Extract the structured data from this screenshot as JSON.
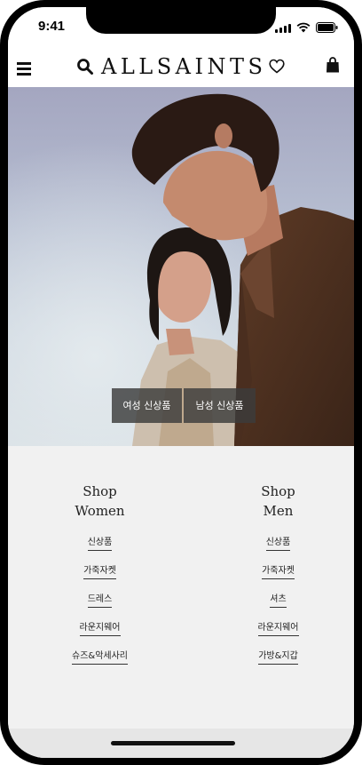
{
  "status": {
    "time": "9:41",
    "icons": [
      "cellular-signal-icon",
      "wifi-icon",
      "battery-icon"
    ]
  },
  "header": {
    "brand": "ALLSAINTS",
    "icons": [
      "menu-icon",
      "search-icon",
      "heart-icon",
      "bag-icon"
    ]
  },
  "hero": {
    "women_button": "여성 신상품",
    "men_button": "남성 신상품"
  },
  "shop": {
    "women": {
      "title_line1": "Shop",
      "title_line2": "Women",
      "links": [
        "신상품",
        "가죽자켓",
        "드레스",
        "라운지웨어",
        "슈즈&악세사리"
      ]
    },
    "men": {
      "title_line1": "Shop",
      "title_line2": "Men",
      "links": [
        "신상품",
        "가죽자켓",
        "셔츠",
        "라운지웨어",
        "가방&지갑"
      ]
    }
  },
  "colors": {
    "frame": "#000000",
    "background": "#f1f1f1",
    "button_bg": "#3c3c3c"
  }
}
